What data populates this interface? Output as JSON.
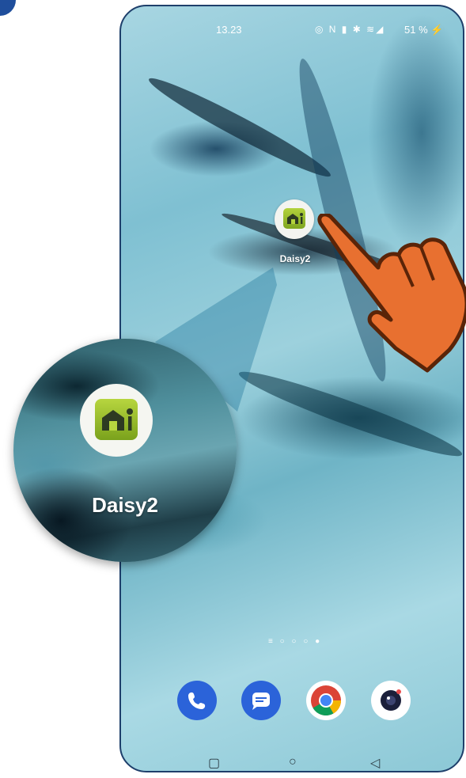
{
  "status_bar": {
    "time": "13.23",
    "icons": "◎ N ▮ ✱ ≋◢",
    "battery": "51 % ⚡"
  },
  "home": {
    "app_label": "Daisy2",
    "page_indicator": "≡ ○ ○ ○ ●"
  },
  "dock": {
    "items": [
      "phone-app",
      "messages-app",
      "chrome-app",
      "camera-app"
    ]
  },
  "nav_bar": {
    "recents": "▢",
    "home": "○",
    "back": "◁"
  },
  "zoom": {
    "app_label": "Daisy2"
  },
  "colors": {
    "accent_orange": "#e87030",
    "phone_border": "#1e3f6b",
    "app_green": "#9bc22f"
  }
}
